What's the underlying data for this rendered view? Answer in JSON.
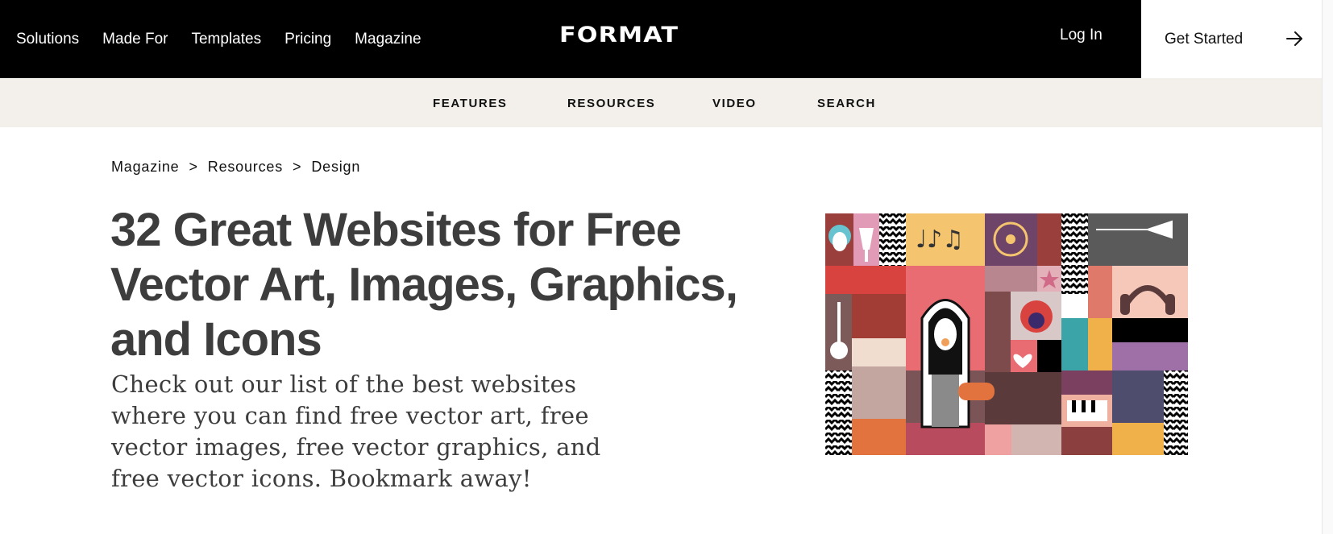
{
  "header": {
    "nav_links": [
      "Solutions",
      "Made For",
      "Templates",
      "Pricing",
      "Magazine"
    ],
    "logo": "FORMAT",
    "login_label": "Log In",
    "cta_label": "Get Started"
  },
  "subnav": {
    "items": [
      "FEATURES",
      "RESOURCES",
      "VIDEO",
      "SEARCH"
    ]
  },
  "breadcrumb": {
    "items": [
      "Magazine",
      "Resources",
      "Design"
    ],
    "separator": ">"
  },
  "article": {
    "title": "32 Great Websites for Free Vector Art, Images, Graphics, and Icons",
    "intro": "Check out our list of the best websites where you can find free vector art, free vector images, free vector graphics, and free vector icons. Bookmark away!"
  },
  "colors": {
    "topbar_bg": "#000000",
    "subbar_bg": "#f3f0ec",
    "title_text": "#3d3d3d"
  },
  "icons": {
    "cta_icon": "arrow-right-icon"
  }
}
